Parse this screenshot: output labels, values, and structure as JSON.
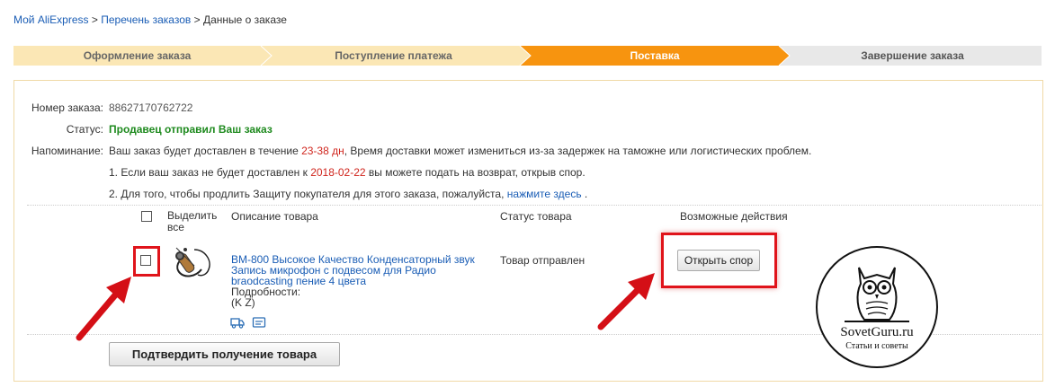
{
  "breadcrumb": {
    "my_aliexpress": "Мой AliExpress",
    "sep1": " > ",
    "orders_list": "Перечень заказов",
    "sep2": " > ",
    "current": "Данные о заказе"
  },
  "steps": [
    {
      "label": "Оформление заказа",
      "state": "done"
    },
    {
      "label": "Поступление платежа",
      "state": "done"
    },
    {
      "label": "Поставка",
      "state": "active"
    },
    {
      "label": "Завершение заказа",
      "state": "pending"
    }
  ],
  "colors": {
    "step_done": "#fbe7b5",
    "step_active": "#f7940f",
    "step_pending": "#e8e8e8",
    "link": "#1a5db5",
    "red": "#d0261e",
    "green": "#1e8a1e",
    "highlight": "#e0141b"
  },
  "order": {
    "number_label": "Номер заказа:",
    "number_value": "88627170762722",
    "status_label": "Статус:",
    "status_value": "Продавец отправил Ваш заказ",
    "reminder_label": "Напоминание:",
    "reminder_pre": "Ваш заказ будет доставлен в течение ",
    "reminder_days": "23-38 дн",
    "reminder_post": ", Время доставки может измениться из-за задержек на таможне или логистических проблем.",
    "note1_pre": "1. Если ваш заказ не будет доставлен к ",
    "note1_date": "2018-02-22",
    "note1_post": " вы можете подать на возврат, открыв спор.",
    "note2_pre": "2. Для того, чтобы продлить Защиту покупателя для этого заказа, пожалуйста, ",
    "note2_link": "нажмите здесь",
    "note2_post": " ."
  },
  "table": {
    "col_select_line1": "Выделить",
    "col_select_line2": "все",
    "col_description": "Описание товара",
    "col_status": "Статус товара",
    "col_actions": "Возможные действия"
  },
  "item": {
    "title_line1": "BM-800 Высокое Качество Конденсаторный звук",
    "title_line2": "Запись микрофон с подвесом для Радио",
    "title_line3": "braodcasting пение 4 цвета",
    "details_label": "Подробности:",
    "details_value": "(K Z)",
    "status": "Товар отправлен",
    "action_button": "Открыть спор",
    "icons": [
      "truck-icon",
      "message-icon"
    ]
  },
  "confirm_button": "Подтвердить получение товара",
  "watermark": {
    "site": "SovetGuru.ru",
    "tagline": "Статьи и советы"
  }
}
